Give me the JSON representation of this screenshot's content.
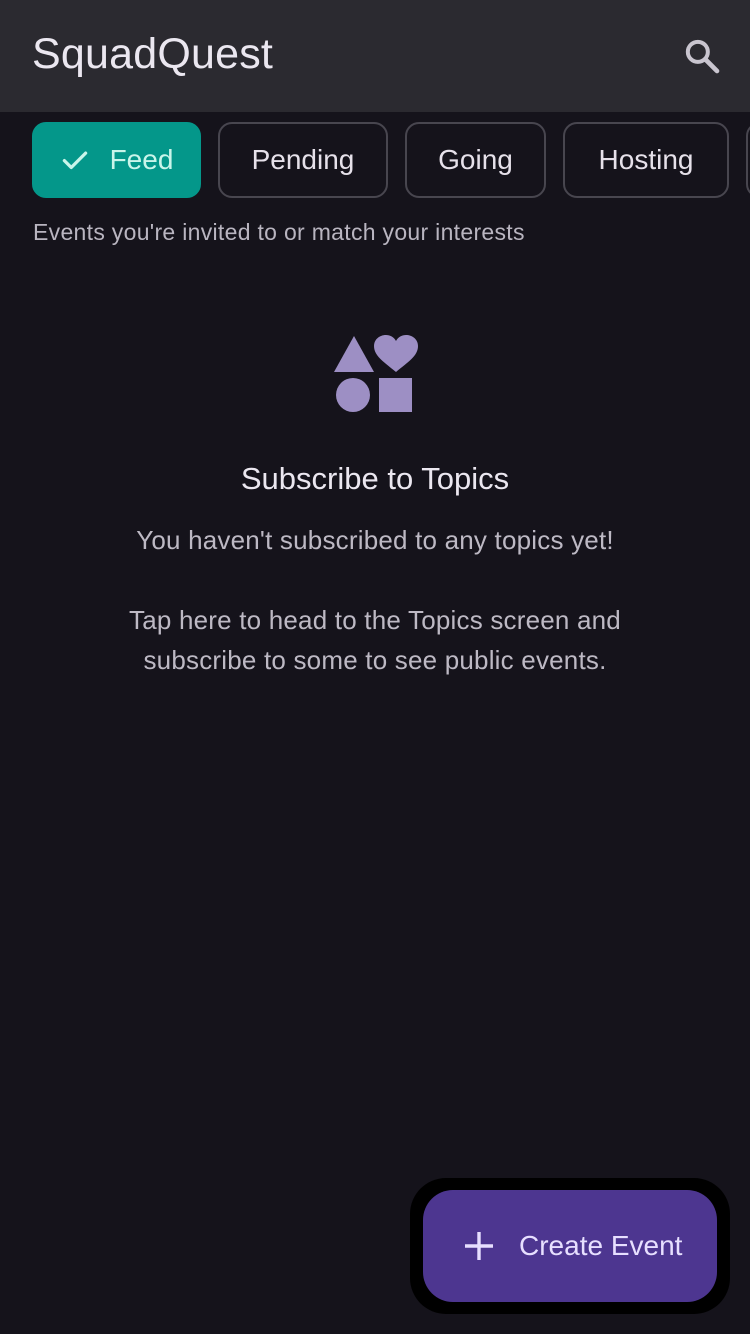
{
  "app_bar": {
    "title": "SquadQuest",
    "search_icon": "search-icon"
  },
  "filters": {
    "chips": [
      {
        "label": "Feed",
        "selected": true,
        "icon": "check-icon"
      },
      {
        "label": "Pending",
        "selected": false
      },
      {
        "label": "Going",
        "selected": false
      },
      {
        "label": "Hosting",
        "selected": false
      },
      {
        "label": "",
        "selected": false
      }
    ],
    "description": "Events you're invited to or match your interests"
  },
  "empty_state": {
    "icon": "topics-shapes-icon",
    "title": "Subscribe to Topics",
    "message": "You haven't subscribed to any topics yet!",
    "action_message": "Tap here to head to the Topics screen and subscribe to some to see public events."
  },
  "fab": {
    "label": "Create Event",
    "icon": "plus-icon"
  },
  "colors": {
    "background": "#15131b",
    "app_bar": "#2b2a30",
    "selected_chip": "#04978a",
    "fab": "#4d3690",
    "icon_accent": "#9d8fc4"
  }
}
